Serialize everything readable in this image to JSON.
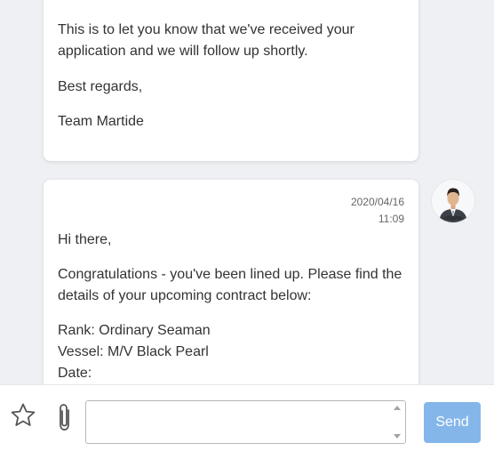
{
  "messages": [
    {
      "lines": [
        "This is to let you know that we've received your application and we will follow up shortly.",
        "Best regards,",
        "Team Martide"
      ]
    },
    {
      "date": "2020/04/16",
      "time": "11:09",
      "greeting": "Hi there,",
      "body": "Congratulations - you've been lined up. Please find the details of your upcoming contract below:",
      "details": [
        "Rank: Ordinary Seaman",
        "Vessel: M/V Black Pearl",
        "Date:"
      ]
    }
  ],
  "avatar": {
    "icon": "user-avatar-icon"
  },
  "composer": {
    "favorite_icon": "star-outline-icon",
    "attach_icon": "paperclip-icon",
    "input_value": "",
    "send_label": "Send",
    "send_color": "#84b6ea"
  }
}
